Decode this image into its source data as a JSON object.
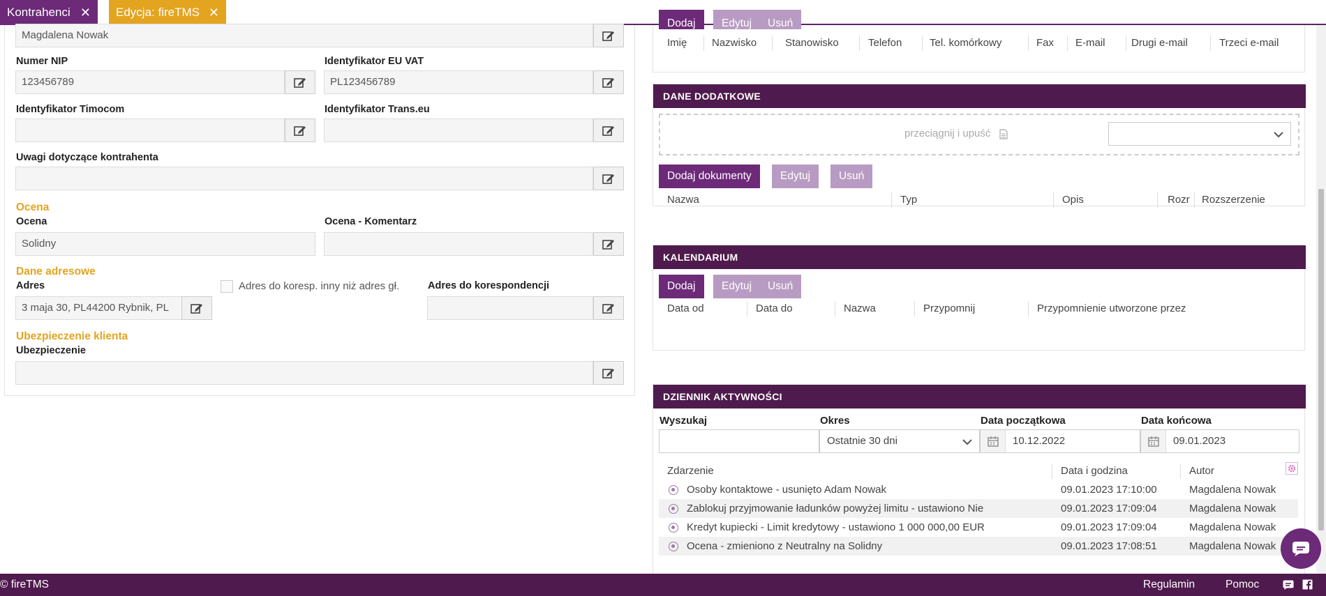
{
  "tabs": [
    {
      "label": "Kontrahenci",
      "close": "✕"
    },
    {
      "label": "Edycja: fireTMS",
      "close": "✕"
    }
  ],
  "left": {
    "top_value": "Magdalena Nowak",
    "nip": {
      "label": "Numer NIP",
      "value": "123456789"
    },
    "euvat": {
      "label": "Identyfikator EU VAT",
      "value": "PL123456789"
    },
    "timocom": {
      "label": "Identyfikator Timocom",
      "value": ""
    },
    "transeu": {
      "label": "Identyfikator Trans.eu",
      "value": ""
    },
    "uwagi": {
      "label": "Uwagi dotyczące kontrahenta",
      "value": ""
    },
    "ocena_section": "Ocena",
    "ocena": {
      "label": "Ocena",
      "value": "Solidny"
    },
    "ocena_kom": {
      "label": "Ocena - Komentarz",
      "value": ""
    },
    "adres_section": "Dane adresowe",
    "adres": {
      "label": "Adres",
      "value": "3 maja 30, PL44200 Rybnik, PL"
    },
    "koresp_check": "Adres do koresp. inny niż adres gł.",
    "koresp": {
      "label": "Adres do korespondencji",
      "value": ""
    },
    "ubezp_section": "Ubezpieczenie klienta",
    "ubezp": {
      "label": "Ubezpieczenie",
      "value": ""
    }
  },
  "contacts": {
    "buttons": [
      "Dodaj",
      "Edytuj",
      "Usuń"
    ],
    "columns": [
      "Imię",
      "Nazwisko",
      "Stanowisko",
      "Telefon",
      "Tel. komórkowy",
      "Fax",
      "E-mail",
      "Drugi e-mail",
      "Trzeci e-mail"
    ]
  },
  "dane": {
    "title": "DANE DODATKOWE",
    "drop": "przeciągnij i upuść",
    "buttons": [
      "Dodaj dokumenty",
      "Edytuj",
      "Usuń"
    ],
    "columns": [
      "Nazwa",
      "Typ",
      "Opis",
      "Rozr",
      "Rozszerzenie"
    ]
  },
  "kal": {
    "title": "KALENDARIUM",
    "buttons": [
      "Dodaj",
      "Edytuj",
      "Usuń"
    ],
    "columns": [
      "Data od",
      "Data do",
      "Nazwa",
      "Przypomnij",
      "Przypomnienie utworzone przez"
    ]
  },
  "dziennik": {
    "title": "DZIENNIK AKTYWNOŚCI",
    "search_label": "Wyszukaj",
    "search_value": "",
    "okres_label": "Okres",
    "okres_value": "Ostatnie 30 dni",
    "start_label": "Data początkowa",
    "start_value": "10.12.2022",
    "end_label": "Data końcowa",
    "end_value": "09.01.2023",
    "columns": [
      "Zdarzenie",
      "Data i godzina",
      "Autor"
    ],
    "rows": [
      {
        "event": "Osoby kontaktowe - usunięto Adam Nowak",
        "date": "09.01.2023 17:10:00",
        "author": "Magdalena Nowak"
      },
      {
        "event": "Zablokuj przyjmowanie ładunków powyżej limitu - ustawiono Nie",
        "date": "09.01.2023 17:09:04",
        "author": "Magdalena Nowak"
      },
      {
        "event": "Kredyt kupiecki - Limit kredytowy - ustawiono 1 000 000,00 EUR",
        "date": "09.01.2023 17:09:04",
        "author": "Magdalena Nowak"
      },
      {
        "event": "Ocena - zmieniono z Neutralny na Solidny",
        "date": "09.01.2023 17:08:51",
        "author": "Magdalena Nowak"
      }
    ]
  },
  "footer": {
    "brand": "© fireTMS",
    "regulamin": "Regulamin",
    "pomoc": "Pomoc"
  }
}
